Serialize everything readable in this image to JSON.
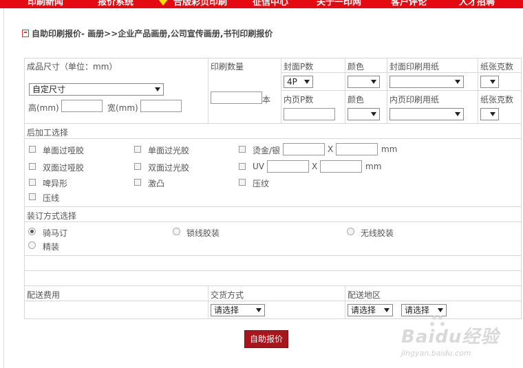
{
  "nav": {
    "items": [
      "印刷新闻",
      "报价系统",
      "合版彩页印刷",
      "征信中心",
      "关于一印网",
      "客户评论",
      "人才招聘"
    ]
  },
  "page": {
    "heading": "自助印刷报价- 画册>>企业产品画册,公司宣传画册,书刊印刷报价"
  },
  "size": {
    "header": "成品尺寸（单位：mm）",
    "select_value": "自定尺寸",
    "height_label": "高(mm)",
    "width_label": "宽(mm)"
  },
  "quantity": {
    "header": "印刷数量",
    "unit": "本"
  },
  "cover": {
    "pages_header": "封面P数",
    "pages_value": "4P",
    "color_header": "颜色",
    "paper_header": "封面印刷用纸",
    "weight_header": "纸张克数"
  },
  "inner": {
    "pages_header": "内页P数",
    "color_header": "颜色",
    "paper_header": "内页印刷用纸",
    "weight_header": "纸张克数"
  },
  "post": {
    "header": "后加工选择",
    "single_matte": "单面过哑胶",
    "single_gloss": "单面过光胶",
    "hot_stamp": "烫金/银",
    "double_matte": "双面过哑胶",
    "double_gloss": "双面过光胶",
    "uv": "UV",
    "die_cut": "啤异形",
    "emboss": "激凸",
    "texture": "压纹",
    "crease": "压线",
    "x": "X",
    "mm": "mm"
  },
  "binding": {
    "header": "装订方式选择",
    "saddle": "骑马订",
    "sewn": "锁线胶装",
    "perfect": "无线胶装",
    "hardcover": "精装"
  },
  "delivery": {
    "fee_header": "配送费用",
    "method_header": "交货方式",
    "area_header": "配送地区",
    "method_value": "请选择",
    "province_value": "请选择",
    "city_value": "请选择"
  },
  "submit_label": "自助报价",
  "watermark": {
    "main": "Baidu经验",
    "sub": "jingyan.baidu.com"
  },
  "colors": {
    "nav_red": "#e40a12",
    "button_red": "#a7151d"
  }
}
